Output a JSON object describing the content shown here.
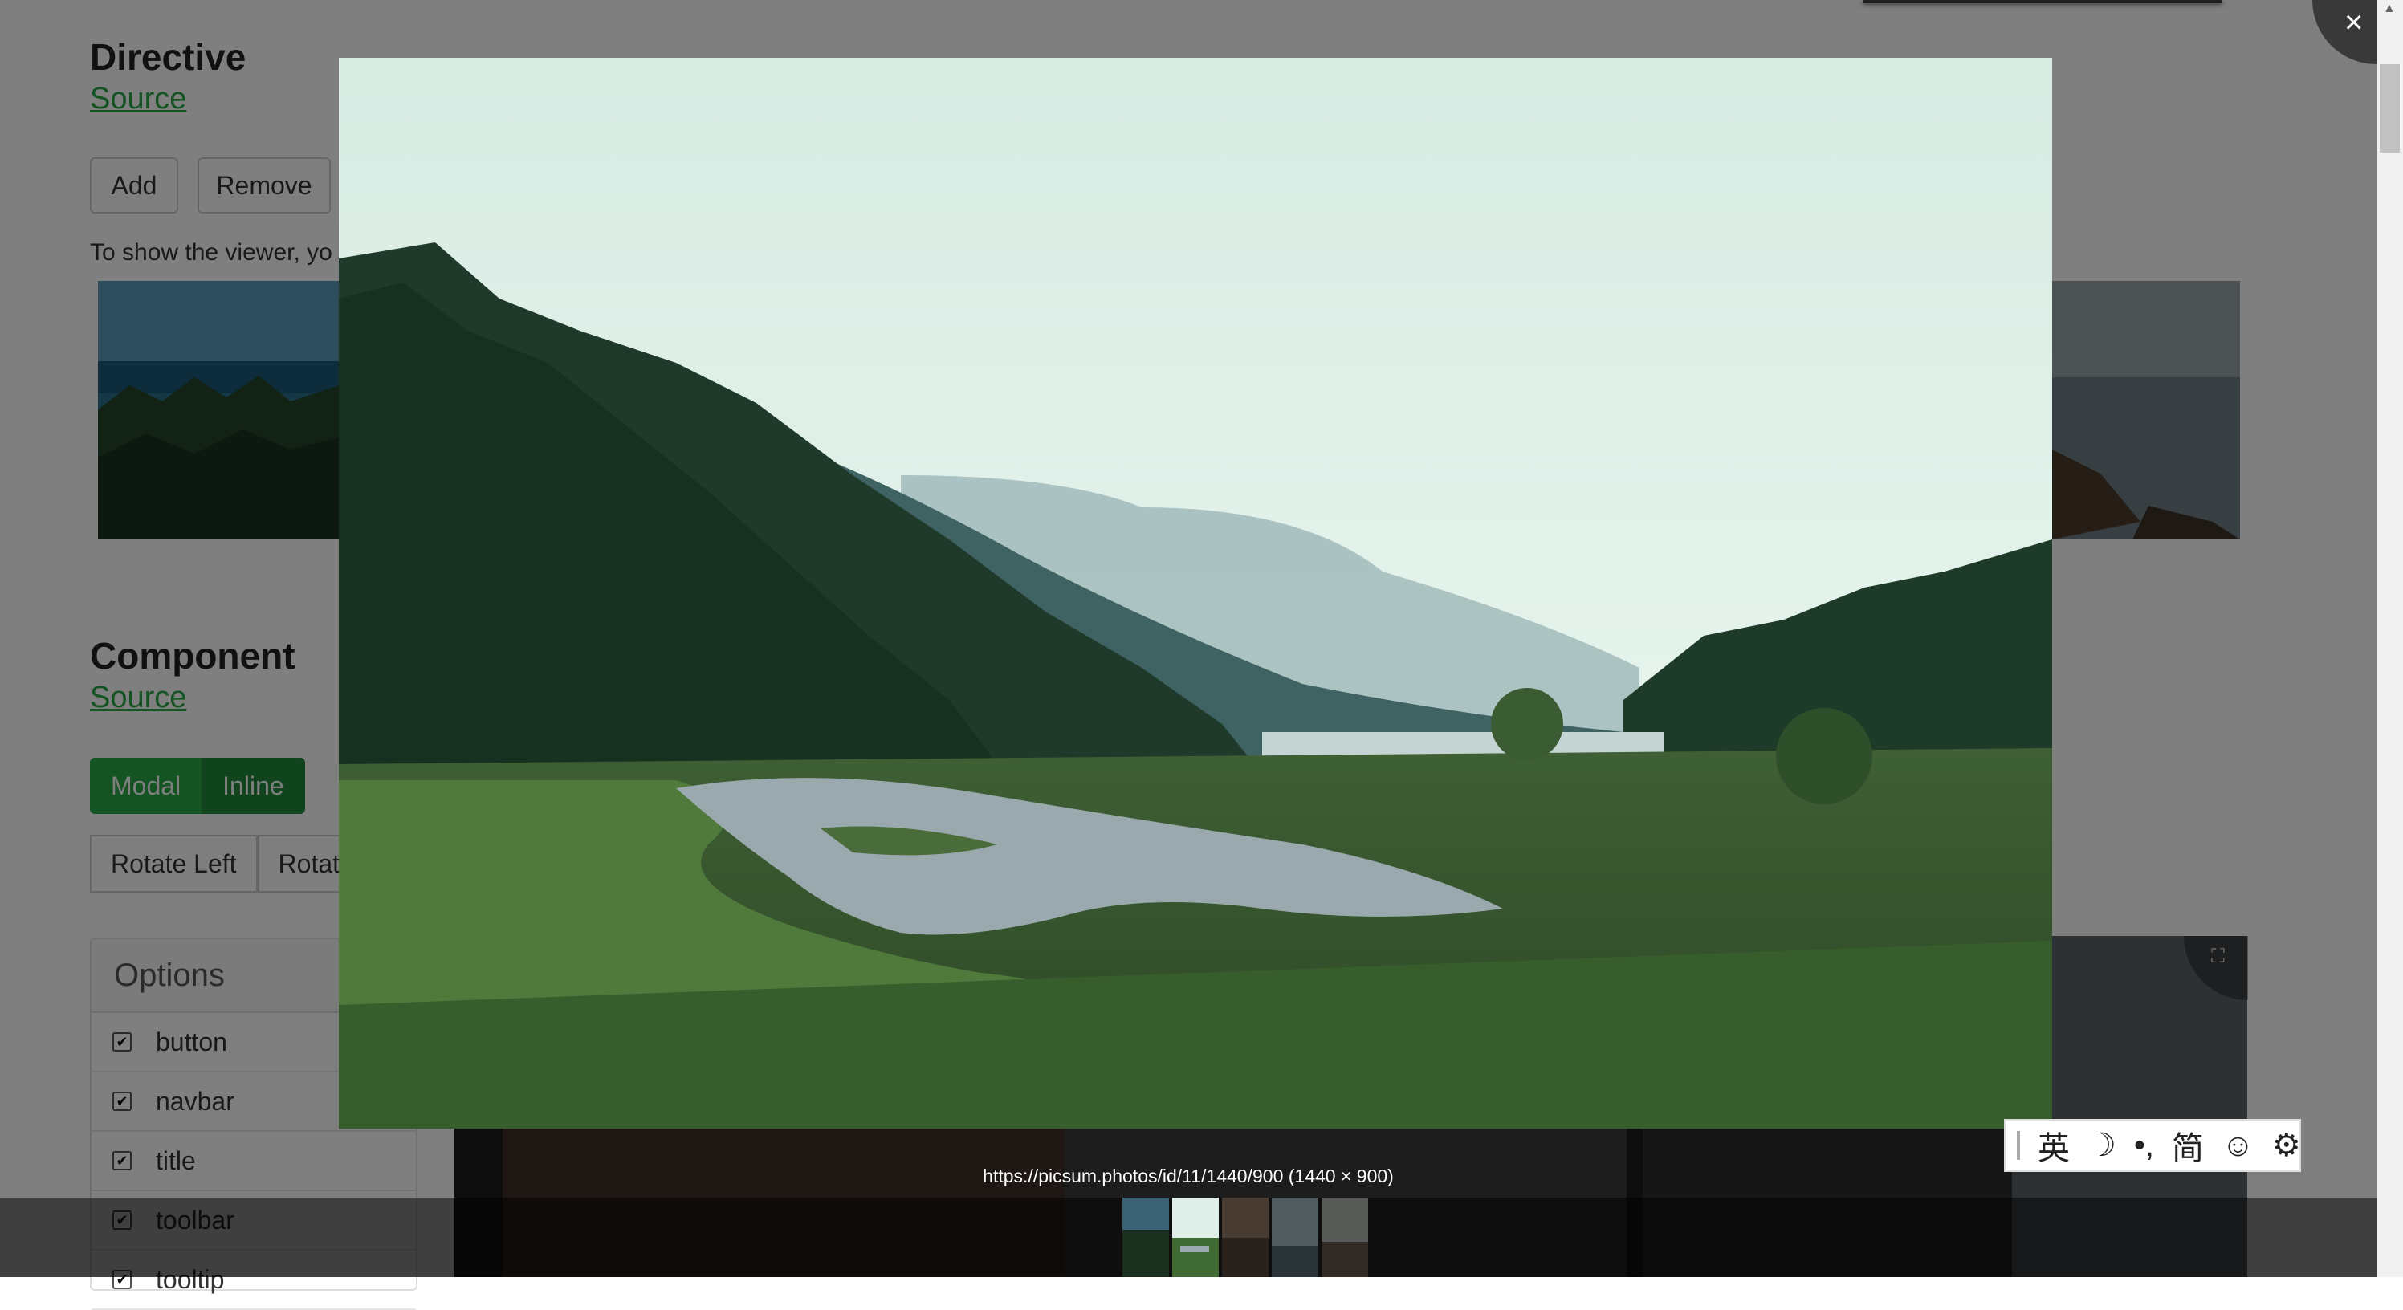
{
  "directive": {
    "title": "Directive",
    "source": "Source",
    "buttons": {
      "add": "Add",
      "remove": "Remove"
    },
    "intro_text": "To show the viewer, yo"
  },
  "component": {
    "title": "Component",
    "source": "Source",
    "toggle": {
      "modal": "Modal",
      "inline": "Inline"
    },
    "rotate": {
      "left": "Rotate Left",
      "right": "Rotate"
    }
  },
  "options": {
    "heading": "Options",
    "items": [
      {
        "label": "button",
        "checked": true
      },
      {
        "label": "navbar",
        "checked": true
      },
      {
        "label": "title",
        "checked": true
      },
      {
        "label": "toolbar",
        "checked": true
      },
      {
        "label": "tooltip",
        "checked": true
      }
    ]
  },
  "viewer": {
    "title": "https://picsum.photos/id/11/1440/900 (1440 × 900)",
    "close_icon": "×",
    "navbar_count": 5,
    "active_index": 1
  },
  "ime": {
    "items": [
      "英",
      "☽",
      "•,",
      "简",
      "☺",
      "⚙"
    ]
  },
  "colors": {
    "accent": "#28a745",
    "overlay": "rgba(0,0,0,0.5)"
  }
}
